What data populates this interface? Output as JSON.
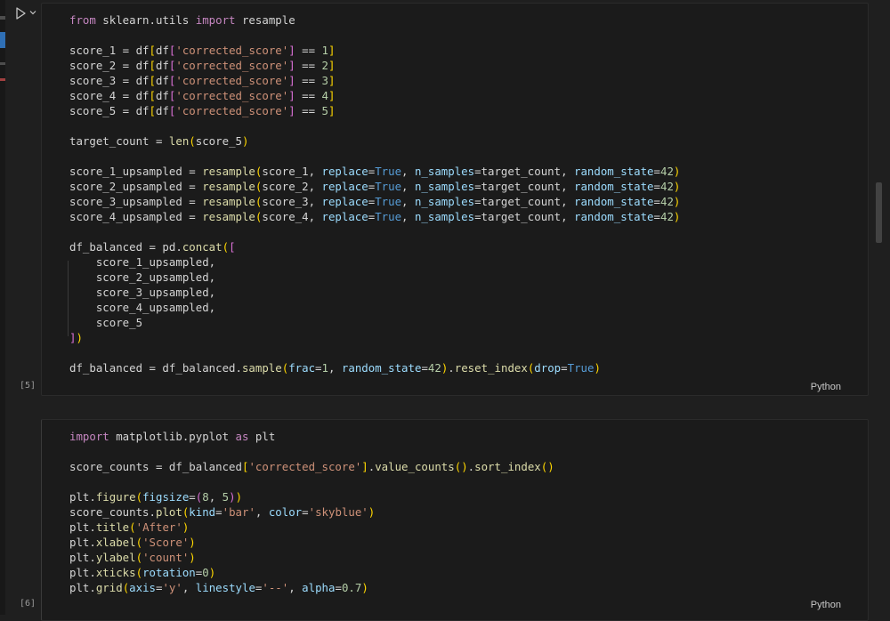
{
  "cells": [
    {
      "exec_count": "[5]",
      "language": "Python",
      "lines": [
        [
          [
            "from",
            "kw"
          ],
          [
            " sklearn.utils ",
            ""
          ],
          [
            "import",
            "kw"
          ],
          [
            " resample",
            ""
          ]
        ],
        [],
        [
          [
            "score_1 = df",
            ""
          ],
          [
            "[",
            "br1"
          ],
          [
            "df",
            ""
          ],
          [
            "[",
            "br2"
          ],
          [
            "'corrected_score'",
            "str"
          ],
          [
            "]",
            "br2"
          ],
          [
            " == ",
            ""
          ],
          [
            "1",
            "num"
          ],
          [
            "]",
            "br1"
          ]
        ],
        [
          [
            "score_2 = df",
            ""
          ],
          [
            "[",
            "br1"
          ],
          [
            "df",
            ""
          ],
          [
            "[",
            "br2"
          ],
          [
            "'corrected_score'",
            "str"
          ],
          [
            "]",
            "br2"
          ],
          [
            " == ",
            ""
          ],
          [
            "2",
            "num"
          ],
          [
            "]",
            "br1"
          ]
        ],
        [
          [
            "score_3 = df",
            ""
          ],
          [
            "[",
            "br1"
          ],
          [
            "df",
            ""
          ],
          [
            "[",
            "br2"
          ],
          [
            "'corrected_score'",
            "str"
          ],
          [
            "]",
            "br2"
          ],
          [
            " == ",
            ""
          ],
          [
            "3",
            "num"
          ],
          [
            "]",
            "br1"
          ]
        ],
        [
          [
            "score_4 = df",
            ""
          ],
          [
            "[",
            "br1"
          ],
          [
            "df",
            ""
          ],
          [
            "[",
            "br2"
          ],
          [
            "'corrected_score'",
            "str"
          ],
          [
            "]",
            "br2"
          ],
          [
            " == ",
            ""
          ],
          [
            "4",
            "num"
          ],
          [
            "]",
            "br1"
          ]
        ],
        [
          [
            "score_5 = df",
            ""
          ],
          [
            "[",
            "br1"
          ],
          [
            "df",
            ""
          ],
          [
            "[",
            "br2"
          ],
          [
            "'corrected_score'",
            "str"
          ],
          [
            "]",
            "br2"
          ],
          [
            " == ",
            ""
          ],
          [
            "5",
            "num"
          ],
          [
            "]",
            "br1"
          ]
        ],
        [],
        [
          [
            "target_count = ",
            ""
          ],
          [
            "len",
            "fn"
          ],
          [
            "(",
            "br1"
          ],
          [
            "score_5",
            ""
          ],
          [
            ")",
            "br1"
          ]
        ],
        [],
        [
          [
            "score_1_upsampled = ",
            ""
          ],
          [
            "resample",
            "fn"
          ],
          [
            "(",
            "br1"
          ],
          [
            "score_1, ",
            ""
          ],
          [
            "replace",
            "par"
          ],
          [
            "=",
            ""
          ],
          [
            "True",
            "bool"
          ],
          [
            ", ",
            ""
          ],
          [
            "n_samples",
            "par"
          ],
          [
            "=target_count, ",
            ""
          ],
          [
            "random_state",
            "par"
          ],
          [
            "=",
            ""
          ],
          [
            "42",
            "num"
          ],
          [
            ")",
            "br1"
          ]
        ],
        [
          [
            "score_2_upsampled = ",
            ""
          ],
          [
            "resample",
            "fn"
          ],
          [
            "(",
            "br1"
          ],
          [
            "score_2, ",
            ""
          ],
          [
            "replace",
            "par"
          ],
          [
            "=",
            ""
          ],
          [
            "True",
            "bool"
          ],
          [
            ", ",
            ""
          ],
          [
            "n_samples",
            "par"
          ],
          [
            "=target_count, ",
            ""
          ],
          [
            "random_state",
            "par"
          ],
          [
            "=",
            ""
          ],
          [
            "42",
            "num"
          ],
          [
            ")",
            "br1"
          ]
        ],
        [
          [
            "score_3_upsampled = ",
            ""
          ],
          [
            "resample",
            "fn"
          ],
          [
            "(",
            "br1"
          ],
          [
            "score_3, ",
            ""
          ],
          [
            "replace",
            "par"
          ],
          [
            "=",
            ""
          ],
          [
            "True",
            "bool"
          ],
          [
            ", ",
            ""
          ],
          [
            "n_samples",
            "par"
          ],
          [
            "=target_count, ",
            ""
          ],
          [
            "random_state",
            "par"
          ],
          [
            "=",
            ""
          ],
          [
            "42",
            "num"
          ],
          [
            ")",
            "br1"
          ]
        ],
        [
          [
            "score_4_upsampled = ",
            ""
          ],
          [
            "resample",
            "fn"
          ],
          [
            "(",
            "br1"
          ],
          [
            "score_4, ",
            ""
          ],
          [
            "replace",
            "par"
          ],
          [
            "=",
            ""
          ],
          [
            "True",
            "bool"
          ],
          [
            ", ",
            ""
          ],
          [
            "n_samples",
            "par"
          ],
          [
            "=target_count, ",
            ""
          ],
          [
            "random_state",
            "par"
          ],
          [
            "=",
            ""
          ],
          [
            "42",
            "num"
          ],
          [
            ")",
            "br1"
          ]
        ],
        [],
        [
          [
            "df_balanced = pd.",
            ""
          ],
          [
            "concat",
            "fn"
          ],
          [
            "(",
            "br1"
          ],
          [
            "[",
            "br2"
          ]
        ],
        [
          [
            "    score_1_upsampled,",
            ""
          ]
        ],
        [
          [
            "    score_2_upsampled,",
            ""
          ]
        ],
        [
          [
            "    score_3_upsampled,",
            ""
          ]
        ],
        [
          [
            "    score_4_upsampled,",
            ""
          ]
        ],
        [
          [
            "    score_5",
            ""
          ]
        ],
        [
          [
            "]",
            "br2"
          ],
          [
            ")",
            "br1"
          ]
        ],
        [],
        [
          [
            "df_balanced = df_balanced.",
            ""
          ],
          [
            "sample",
            "fn"
          ],
          [
            "(",
            "br1"
          ],
          [
            "frac",
            "par"
          ],
          [
            "=",
            ""
          ],
          [
            "1",
            "num"
          ],
          [
            ", ",
            ""
          ],
          [
            "random_state",
            "par"
          ],
          [
            "=",
            ""
          ],
          [
            "42",
            "num"
          ],
          [
            ")",
            "br1"
          ],
          [
            ".",
            ""
          ],
          [
            "reset_index",
            "fn"
          ],
          [
            "(",
            "br1"
          ],
          [
            "drop",
            "par"
          ],
          [
            "=",
            ""
          ],
          [
            "True",
            "bool"
          ],
          [
            ")",
            "br1"
          ]
        ]
      ]
    },
    {
      "exec_count": "[6]",
      "language": "Python",
      "lines": [
        [
          [
            "import",
            "kw"
          ],
          [
            " matplotlib.pyplot ",
            ""
          ],
          [
            "as",
            "kw"
          ],
          [
            " plt",
            ""
          ]
        ],
        [],
        [
          [
            "score_counts = df_balanced",
            ""
          ],
          [
            "[",
            "br1"
          ],
          [
            "'corrected_score'",
            "str"
          ],
          [
            "]",
            "br1"
          ],
          [
            ".",
            ""
          ],
          [
            "value_counts",
            "fn"
          ],
          [
            "(",
            "br1"
          ],
          [
            ")",
            "br1"
          ],
          [
            ".",
            ""
          ],
          [
            "sort_index",
            "fn"
          ],
          [
            "(",
            "br1"
          ],
          [
            ")",
            "br1"
          ]
        ],
        [],
        [
          [
            "plt.",
            ""
          ],
          [
            "figure",
            "fn"
          ],
          [
            "(",
            "br1"
          ],
          [
            "figsize",
            "par"
          ],
          [
            "=",
            ""
          ],
          [
            "(",
            "br2"
          ],
          [
            "8",
            "num"
          ],
          [
            ", ",
            ""
          ],
          [
            "5",
            "num"
          ],
          [
            ")",
            "br2"
          ],
          [
            ")",
            "br1"
          ]
        ],
        [
          [
            "score_counts.",
            ""
          ],
          [
            "plot",
            "fn"
          ],
          [
            "(",
            "br1"
          ],
          [
            "kind",
            "par"
          ],
          [
            "=",
            ""
          ],
          [
            "'bar'",
            "str"
          ],
          [
            ", ",
            ""
          ],
          [
            "color",
            "par"
          ],
          [
            "=",
            ""
          ],
          [
            "'skyblue'",
            "str"
          ],
          [
            ")",
            "br1"
          ]
        ],
        [
          [
            "plt.",
            ""
          ],
          [
            "title",
            "fn"
          ],
          [
            "(",
            "br1"
          ],
          [
            "'After'",
            "str"
          ],
          [
            ")",
            "br1"
          ]
        ],
        [
          [
            "plt.",
            ""
          ],
          [
            "xlabel",
            "fn"
          ],
          [
            "(",
            "br1"
          ],
          [
            "'Score'",
            "str"
          ],
          [
            ")",
            "br1"
          ]
        ],
        [
          [
            "plt.",
            ""
          ],
          [
            "ylabel",
            "fn"
          ],
          [
            "(",
            "br1"
          ],
          [
            "'count'",
            "str"
          ],
          [
            ")",
            "br1"
          ]
        ],
        [
          [
            "plt.",
            ""
          ],
          [
            "xticks",
            "fn"
          ],
          [
            "(",
            "br1"
          ],
          [
            "rotation",
            "par"
          ],
          [
            "=",
            ""
          ],
          [
            "0",
            "num"
          ],
          [
            ")",
            "br1"
          ]
        ],
        [
          [
            "plt.",
            ""
          ],
          [
            "grid",
            "fn"
          ],
          [
            "(",
            "br1"
          ],
          [
            "axis",
            "par"
          ],
          [
            "=",
            ""
          ],
          [
            "'y'",
            "str"
          ],
          [
            ", ",
            ""
          ],
          [
            "linestyle",
            "par"
          ],
          [
            "=",
            ""
          ],
          [
            "'--'",
            "str"
          ],
          [
            ", ",
            ""
          ],
          [
            "alpha",
            "par"
          ],
          [
            "=",
            ""
          ],
          [
            "0.7",
            "num"
          ],
          [
            ")",
            "br1"
          ]
        ]
      ]
    }
  ],
  "icons": {
    "run": "run-cell-icon",
    "expand": "chevron-down-icon"
  },
  "colors": {
    "keyword": "#c586c0",
    "function": "#dcdcaa",
    "string": "#ce9178",
    "number": "#b5cea8",
    "parameter": "#9cdcfe",
    "bool": "#569cd6"
  }
}
